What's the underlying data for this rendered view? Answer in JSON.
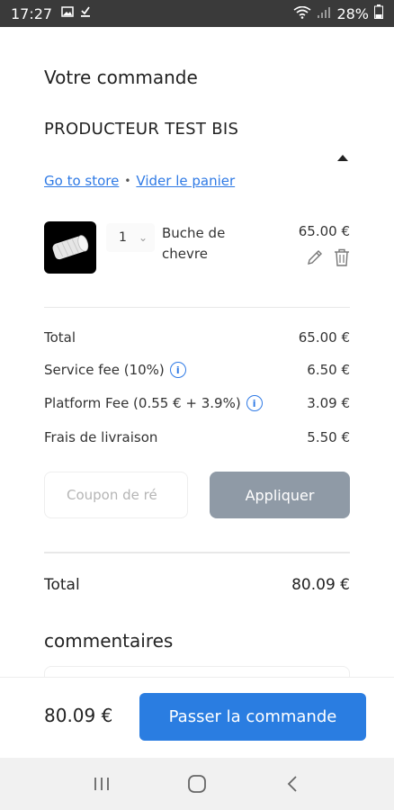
{
  "status_bar": {
    "time": "17:27",
    "battery": "28%"
  },
  "page": {
    "title": "Votre commande"
  },
  "store": {
    "name": "PRODUCTEUR TEST BIS",
    "go_to_store": "Go to store",
    "empty_cart": "Vider le panier"
  },
  "cart_item": {
    "quantity": "1",
    "name": "Buche de chevre",
    "price": "65.00 €"
  },
  "summary": {
    "total_label": "Total",
    "total_value": "65.00 €",
    "service_fee_label": "Service fee (10%)",
    "service_fee_value": "6.50 €",
    "platform_fee_label": "Platform Fee (0.55 € + 3.9%)",
    "platform_fee_value": "3.09 €",
    "delivery_label": "Frais de livraison",
    "delivery_value": "5.50 €"
  },
  "coupon": {
    "placeholder": "Coupon de ré",
    "apply_label": "Appliquer"
  },
  "grand_total": {
    "label": "Total",
    "value": "80.09 €"
  },
  "comments": {
    "title": "commentaires"
  },
  "footer": {
    "total": "80.09 €",
    "order_label": "Passer la commande"
  },
  "colors": {
    "accent": "#2a7de1",
    "link": "#2f7ae5",
    "apply_disabled": "#8f9aa6"
  }
}
